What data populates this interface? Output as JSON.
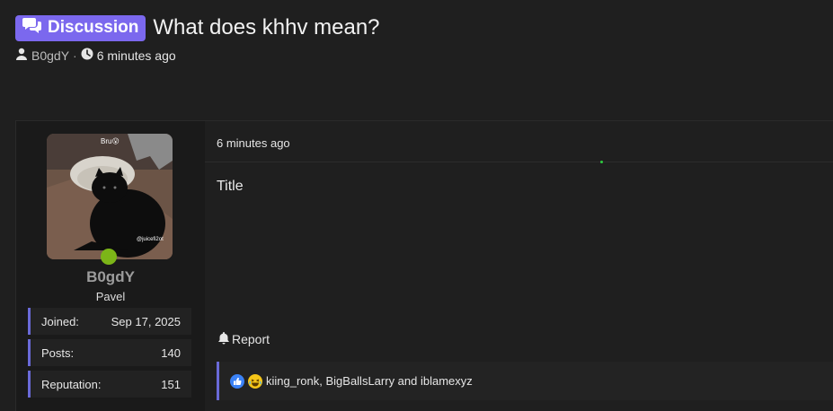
{
  "thread": {
    "prefix": "Discussion",
    "title": "What does khhv mean?",
    "author": "B0gdY",
    "separator": "·",
    "time_ago": "6 minutes ago"
  },
  "post": {
    "date": "6 minutes ago",
    "body": "Title",
    "report_label": "Report",
    "reactions_text": "kiing_ronk, BigBallsLarry and iblamexyz",
    "reaction_icons": [
      "like-icon",
      "laugh-icon"
    ]
  },
  "user": {
    "username": "B0gdY",
    "user_title": "Pavel",
    "avatar_caption": "@juicefi2ot",
    "avatar_top_text": "Bru😮",
    "online": true,
    "stats": [
      {
        "label": "Joined:",
        "value": "Sep 17, 2025"
      },
      {
        "label": "Posts:",
        "value": "140"
      },
      {
        "label": "Reputation:",
        "value": "151"
      }
    ]
  },
  "colors": {
    "accent": "#7b68ee",
    "online": "#7cb518",
    "stat_border": "#6a6ad8"
  }
}
